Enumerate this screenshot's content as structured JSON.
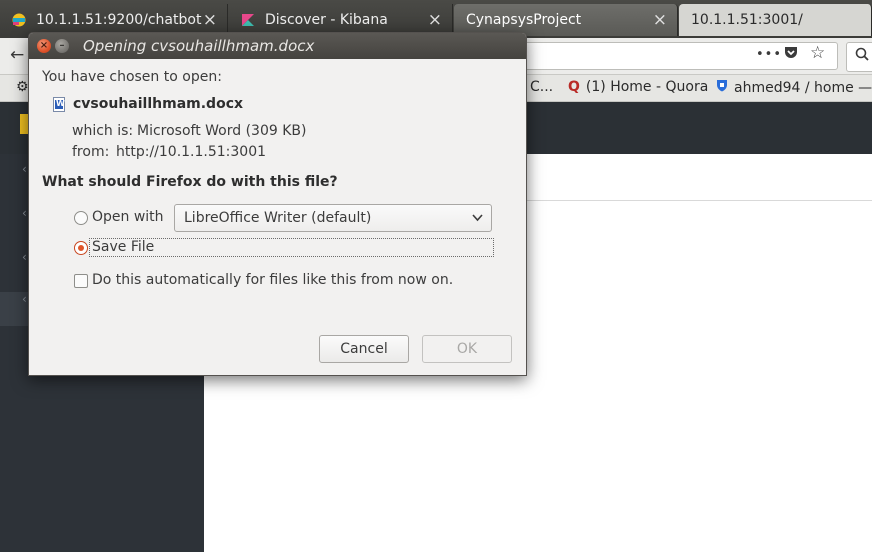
{
  "browser": {
    "tabs": [
      {
        "label": "10.1.1.51:9200/chatbot",
        "state": "inactive",
        "close": "×"
      },
      {
        "label": "Discover - Kibana",
        "state": "inactive",
        "close": "×"
      },
      {
        "label": "CynapsysProject",
        "state": "active",
        "close": "×"
      },
      {
        "label": "10.1.1.51:3001/",
        "state": "light",
        "close": ""
      }
    ],
    "navbar": {
      "overflow_label": "•••"
    },
    "bookmarks": [
      {
        "icon": "C",
        "label": "C..."
      },
      {
        "icon": "Q",
        "label": "(1) Home - Quora"
      },
      {
        "icon": "shield-icon",
        "label": "ahmed94 / home —"
      }
    ]
  },
  "dialog": {
    "title": "Opening cvsouhaillhmam.docx",
    "intro": "You have chosen to open:",
    "filename": "cvsouhaillhmam.docx",
    "which_is_label": "which is:",
    "which_is_value": "Microsoft Word (309 KB)",
    "from_label": "from:",
    "from_value": "http://10.1.1.51:3001",
    "question": "What should Firefox do with this file?",
    "open_with_label": "Open with",
    "open_with_app": "LibreOffice Writer (default)",
    "save_file_label": "Save File",
    "selected_option": "save_file",
    "auto_label": "Do this automatically for files like this from now on.",
    "auto_checked": false,
    "cancel_label": "Cancel",
    "ok_label": "OK",
    "ok_enabled": false
  },
  "colors": {
    "accent_radio": "#e0562a",
    "titlebar": "#45433f",
    "window_close": "#e0522a"
  }
}
